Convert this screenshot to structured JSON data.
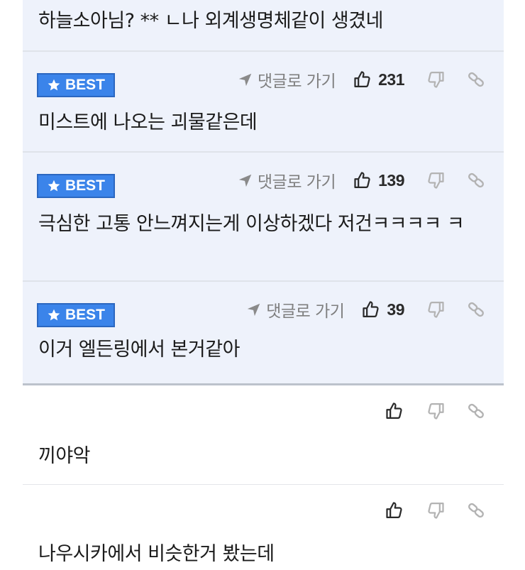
{
  "comments": [
    {
      "text": "하늘소아님? ** ㄴ나 외계생명체같이 생겼네"
    },
    {
      "best_label": "BEST",
      "reply_label": "댓글로 가기",
      "likes": "231",
      "text": "미스트에 나오는 괴물같은데"
    },
    {
      "best_label": "BEST",
      "reply_label": "댓글로 가기",
      "likes": "139",
      "text": "극심한 고통 안느껴지는게 이상하겠다 저건ㅋㅋㅋㅋ ㅋ"
    },
    {
      "best_label": "BEST",
      "reply_label": "댓글로 가기",
      "likes": "39",
      "text": "이거 엘든링에서 본거같아"
    },
    {
      "text": "끼야악"
    },
    {
      "text": "나우시카에서 비슷한거 봤는데"
    }
  ],
  "icons": {
    "badge": "star-icon",
    "reply": "arrow-icon",
    "like": "thumbs-up-icon",
    "dislike": "thumbs-down-icon",
    "link": "link-icon"
  },
  "colors": {
    "best_background": "#eef2fb",
    "badge": "#3b84ea"
  }
}
